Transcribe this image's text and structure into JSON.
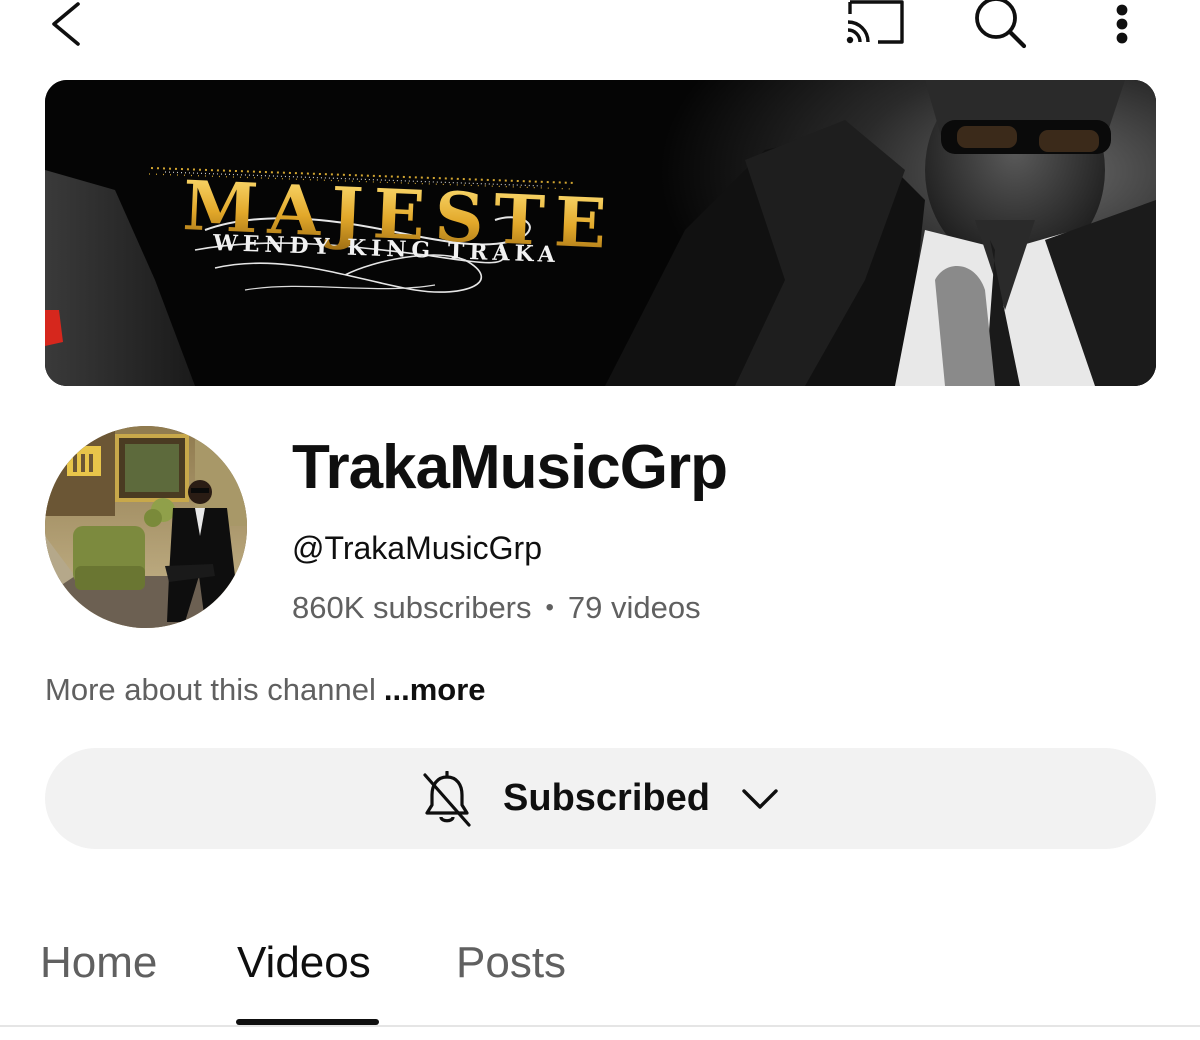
{
  "topbar": {
    "back_icon": "chevron-left-icon",
    "cast_icon": "cast-icon",
    "search_icon": "search-icon",
    "more_icon": "more-vertical-icon"
  },
  "banner": {
    "title": "MAJESTE",
    "subtitle": "WENDY KING TRAKA",
    "colors": {
      "title_gold": "#e8b231",
      "background": "#050505"
    }
  },
  "channel": {
    "name": "TrakaMusicGrp",
    "handle": "@TrakaMusicGrp",
    "subscribers": "860K subscribers",
    "separator": "•",
    "videos": "79 videos",
    "about_text": "More about this channel",
    "about_more": "...more"
  },
  "subscribe": {
    "label": "Subscribed",
    "bell_icon": "bell-off-icon",
    "chevron_icon": "chevron-down-icon",
    "background": "#f2f2f2"
  },
  "tabs": [
    {
      "label": "Home",
      "active": false
    },
    {
      "label": "Videos",
      "active": true
    },
    {
      "label": "Posts",
      "active": false
    }
  ]
}
